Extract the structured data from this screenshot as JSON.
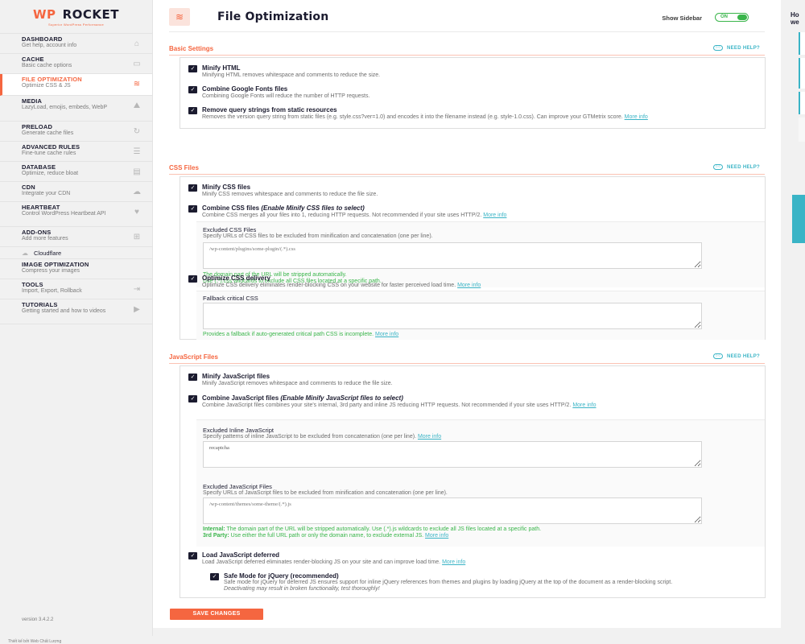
{
  "brand": {
    "name_wp": "WP",
    "name_rocket": "ROCKET",
    "tagline": "Superior WordPress Performance"
  },
  "sidebar": {
    "items": [
      {
        "title": "DASHBOARD",
        "desc": "Get help, account info",
        "icon": "home-icon",
        "glyph": "⌂"
      },
      {
        "title": "CACHE",
        "desc": "Basic cache options",
        "icon": "file-icon",
        "glyph": "▭"
      },
      {
        "title": "FILE OPTIMIZATION",
        "desc": "Optimize CSS & JS",
        "icon": "layers-icon",
        "glyph": "≋"
      },
      {
        "title": "MEDIA",
        "desc": "LazyLoad, emojis, embeds, WebP",
        "icon": "image-icon",
        "glyph": "⛰"
      },
      {
        "title": "PRELOAD",
        "desc": "Generate cache files",
        "icon": "refresh-icon",
        "glyph": "↻"
      },
      {
        "title": "ADVANCED RULES",
        "desc": "Fine-tune cache rules",
        "icon": "list-icon",
        "glyph": "☰"
      },
      {
        "title": "DATABASE",
        "desc": "Optimize, reduce bloat",
        "icon": "database-icon",
        "glyph": "▤"
      },
      {
        "title": "CDN",
        "desc": "Integrate your CDN",
        "icon": "cloud-icon",
        "glyph": "☁"
      },
      {
        "title": "HEARTBEAT",
        "desc": "Control WordPress Heartbeat API",
        "icon": "heart-icon",
        "glyph": "♥"
      },
      {
        "title": "ADD-ONS",
        "desc": "Add more features",
        "icon": "addons-icon",
        "glyph": "⊞"
      },
      {
        "title": "IMAGE OPTIMIZATION",
        "desc": "Compress your images",
        "icon": "",
        "glyph": ""
      },
      {
        "title": "TOOLS",
        "desc": "Import, Export, Rollback",
        "icon": "tools-icon",
        "glyph": "⇥"
      },
      {
        "title": "TUTORIALS",
        "desc": "Getting started and how to videos",
        "icon": "video-icon",
        "glyph": "▶"
      }
    ],
    "cloudflare": "Cloudflare",
    "version": "version 3.4.2.2"
  },
  "header": {
    "title": "File Optimization",
    "show_sidebar": "Show Sidebar",
    "toggle": "ON"
  },
  "need_help": "NEED HELP?",
  "basic": {
    "title": "Basic Settings",
    "minify_html": {
      "title": "Minify HTML",
      "desc": "Minifying HTML removes whitespace and comments to reduce the size."
    },
    "google_fonts": {
      "title": "Combine Google Fonts files",
      "desc": "Combining Google Fonts will reduce the number of HTTP requests."
    },
    "query_strings": {
      "title": "Remove query strings from static resources",
      "desc": "Removes the version query string from static files (e.g. style.css?ver=1.0) and encodes it into the filename instead (e.g. style-1.0.css). Can improve your GTMetrix score.",
      "more": "More info"
    }
  },
  "css": {
    "title": "CSS Files",
    "minify": {
      "title": "Minify CSS files",
      "desc": "Minify CSS removes whitespace and comments to reduce the file size."
    },
    "combine": {
      "title": "Combine CSS files",
      "title_em": "(Enable Minify CSS files to select)",
      "desc": "Combine CSS merges all your files into 1, reducing HTTP requests. Not recommended if your site uses HTTP/2.",
      "more": "More info"
    },
    "excluded": {
      "label": "Excluded CSS Files",
      "desc": "Specify URLs of CSS files to be excluded from minification and concatenation (one per line).",
      "placeholder": "/wp-content/plugins/some-plugin/(.*).css",
      "note1": "The domain part of the URL will be stripped automatically.",
      "note2": "Use (.*).css wildcards to exclude all CSS files located at a specific path."
    },
    "optimize": {
      "title": "Optimize CSS delivery",
      "desc": "Optimize CSS delivery eliminates render-blocking CSS on your website for faster perceived load time.",
      "more": "More info"
    },
    "fallback": {
      "label": "Fallback critical CSS",
      "note": "Provides a fallback if auto-generated critical path CSS is incomplete.",
      "more": "More info"
    }
  },
  "js": {
    "title": "JavaScript Files",
    "minify": {
      "title": "Minify JavaScript files",
      "desc": "Minify JavaScript removes whitespace and comments to reduce the file size."
    },
    "combine": {
      "title": "Combine JavaScript files",
      "title_em": "(Enable Minify JavaScript files to select)",
      "desc": "Combine JavaScript files combines your site's internal, 3rd party and inline JS reducing HTTP requests. Not recommended if your site uses HTTP/2.",
      "more": "More info"
    },
    "inline": {
      "label": "Excluded Inline JavaScript",
      "desc": "Specify patterns of inline JavaScript to be excluded from concatenation (one per line).",
      "more": "More info",
      "value": "recaptcha"
    },
    "excluded": {
      "label": "Excluded JavaScript Files",
      "desc": "Specify URLs of JavaScript files to be excluded from minification and concatenation (one per line).",
      "placeholder": "/wp-content/themes/some-theme/(.*).js",
      "internal_label": "Internal:",
      "internal": "The domain part of the URL will be stripped automatically. Use (.*).js wildcards to exclude all JS files located at a specific path.",
      "third_label": "3rd Party:",
      "third": "Use either the full URL path or only the domain name, to exclude external JS.",
      "more": "More info"
    },
    "defer": {
      "title": "Load JavaScript deferred",
      "desc": "Load JavaScript deferred eliminates render-blocking JS on your site and can improve load time.",
      "more": "More info"
    },
    "safe": {
      "title": "Safe Mode for jQuery (recommended)",
      "desc": "Safe mode for jQuery for deferred JS ensures support for inline jQuery references from themes and plugins by loading jQuery at the top of the document as a render-blocking script.",
      "warn": "Deactivating may result in broken functionality, test thoroughly!"
    }
  },
  "save": "SAVE CHANGES",
  "right": {
    "title": "Ho we"
  },
  "footer": "Thiết kế bởi Web Chất Lượng",
  "colors": {
    "accent": "#f56640",
    "teal": "#3ab4c6",
    "green": "#39b54a",
    "dark": "#1b1b2f"
  }
}
